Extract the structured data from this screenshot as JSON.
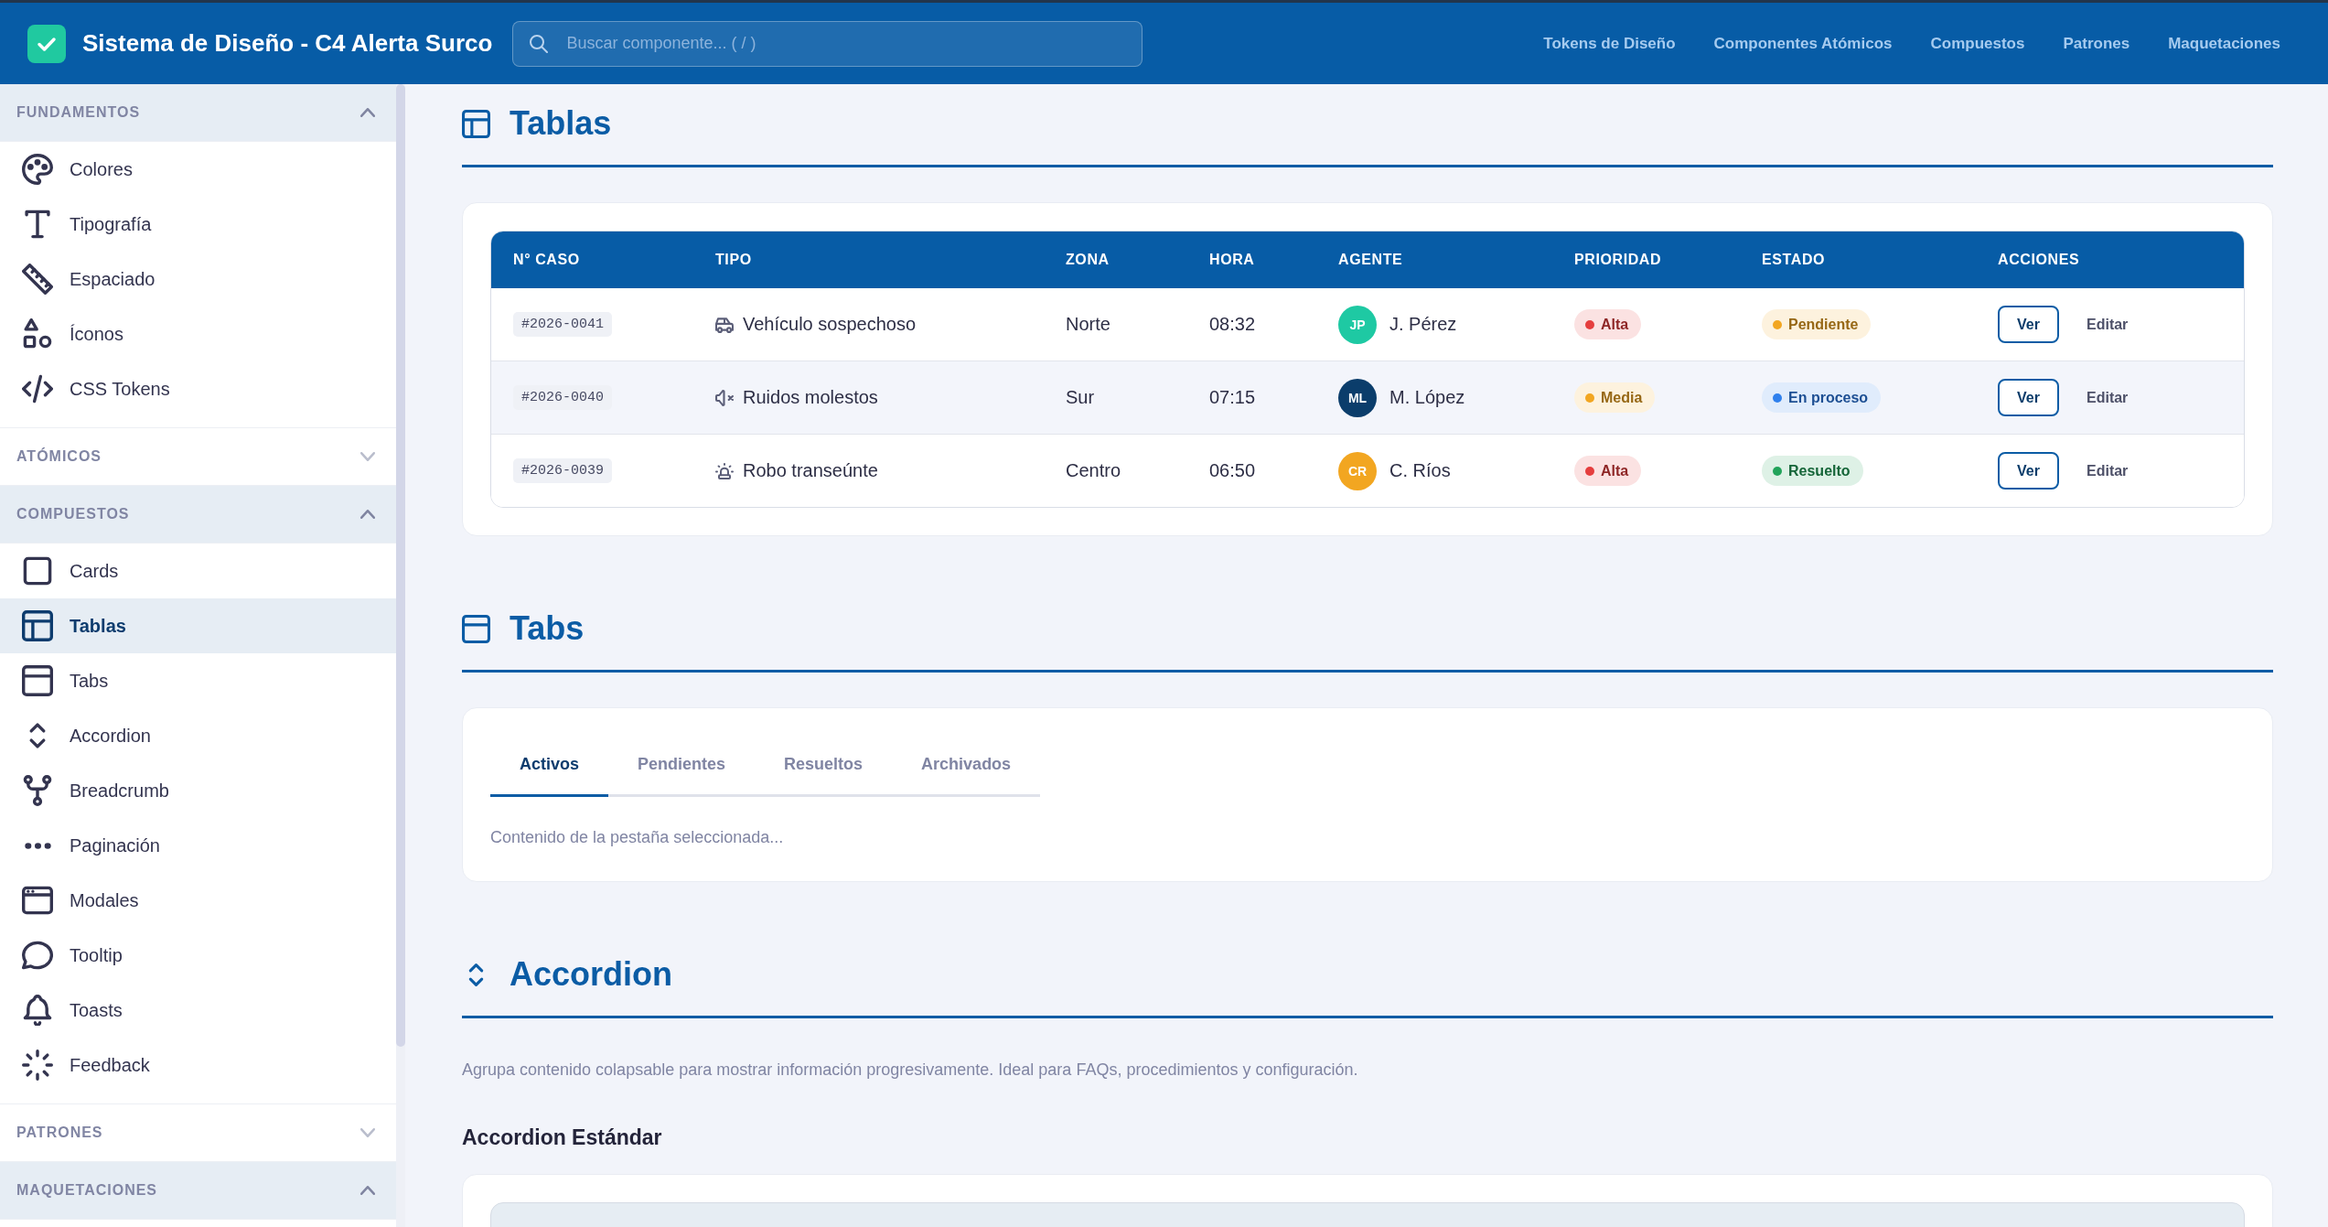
{
  "header": {
    "title": "Sistema de Diseño - C4 Alerta Surco",
    "search": {
      "placeholder": "Buscar componente... ( / )"
    },
    "nav": [
      "Tokens de Diseño",
      "Componentes Atómicos",
      "Compuestos",
      "Patrones",
      "Maquetaciones"
    ]
  },
  "sidebar": {
    "sections": [
      {
        "title": "FUNDAMENTOS",
        "expanded": true,
        "items": [
          {
            "label": "Colores",
            "selected": false
          },
          {
            "label": "Tipografía",
            "selected": false
          },
          {
            "label": "Espaciado",
            "selected": false
          },
          {
            "label": "Íconos",
            "selected": false
          },
          {
            "label": "CSS Tokens",
            "selected": false
          }
        ]
      },
      {
        "title": "ATÓMICOS",
        "expanded": false
      },
      {
        "title": "COMPUESTOS",
        "expanded": true,
        "items": [
          {
            "label": "Cards",
            "selected": false
          },
          {
            "label": "Tablas",
            "selected": true
          },
          {
            "label": "Tabs",
            "selected": false
          },
          {
            "label": "Accordion",
            "selected": false
          },
          {
            "label": "Breadcrumb",
            "selected": false
          },
          {
            "label": "Paginación",
            "selected": false
          },
          {
            "label": "Modales",
            "selected": false
          },
          {
            "label": "Tooltip",
            "selected": false
          },
          {
            "label": "Toasts",
            "selected": false
          },
          {
            "label": "Feedback",
            "selected": false
          }
        ]
      },
      {
        "title": "PATRONES",
        "expanded": false
      },
      {
        "title": "MAQUETACIONES",
        "expanded": true
      }
    ]
  },
  "tables_section": {
    "title": "Tablas",
    "table": {
      "columns": [
        "N° CASO",
        "TIPO",
        "ZONA",
        "HORA",
        "AGENTE",
        "PRIORIDAD",
        "ESTADO",
        "ACCIONES"
      ],
      "rows": [
        {
          "case": "#2026-0041",
          "type": "Vehículo sospechoso",
          "zone": "Norte",
          "time": "08:32",
          "agent": {
            "initials": "JP",
            "name": "J. Pérez",
            "color": "#1ec9a3"
          },
          "priority": {
            "label": "Alta",
            "color": "#e53e3e"
          },
          "status": {
            "label": "Pendiente",
            "color": "#f2a621"
          },
          "actions": [
            "Ver",
            "Editar"
          ]
        },
        {
          "case": "#2026-0040",
          "type": "Ruidos molestos",
          "zone": "Sur",
          "time": "07:15",
          "agent": {
            "initials": "ML",
            "name": "M. López",
            "color": "#0b3d6b"
          },
          "priority": {
            "label": "Media",
            "color": "#f2a621"
          },
          "status": {
            "label": "En proceso",
            "color": "#2f80ed"
          },
          "actions": [
            "Ver",
            "Editar"
          ]
        },
        {
          "case": "#2026-0039",
          "type": "Robo transeúnte",
          "zone": "Centro",
          "time": "06:50",
          "agent": {
            "initials": "CR",
            "name": "C. Ríos",
            "color": "#f2a621"
          },
          "priority": {
            "label": "Alta",
            "color": "#e53e3e"
          },
          "status": {
            "label": "Resuelto",
            "color": "#22a35a"
          },
          "actions": [
            "Ver",
            "Editar"
          ]
        }
      ]
    }
  },
  "tabs_section": {
    "title": "Tabs",
    "tabs": [
      {
        "label": "Activos",
        "selected": true
      },
      {
        "label": "Pendientes",
        "selected": false
      },
      {
        "label": "Resueltos",
        "selected": false
      },
      {
        "label": "Archivados",
        "selected": false
      }
    ],
    "content": "Contenido de la pestaña seleccionada..."
  },
  "accordion_section": {
    "title": "Accordion",
    "description": "Agrupa contenido colapsable para mostrar información progresivamente. Ideal para FAQs, procedimientos y configuración.",
    "subtitle": "Accordion Estándar"
  }
}
